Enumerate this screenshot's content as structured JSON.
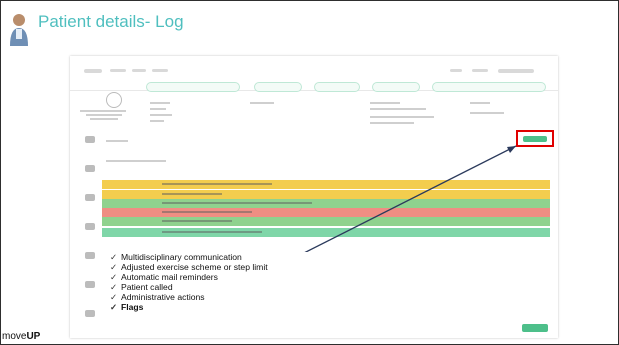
{
  "slide": {
    "title": "Patient details- Log",
    "brand_prefix": "move",
    "brand_suffix": "UP"
  },
  "features": [
    {
      "label": "Multidisciplinary communication",
      "bold": false
    },
    {
      "label": "Adjusted exercise scheme or step limit",
      "bold": false
    },
    {
      "label": "Automatic mail reminders",
      "bold": false
    },
    {
      "label": "Patient called",
      "bold": false
    },
    {
      "label": "Administrative actions",
      "bold": false
    },
    {
      "label": "Flags",
      "bold": true
    }
  ],
  "log_rows": [
    {
      "color": "yellow"
    },
    {
      "color": "yellow"
    },
    {
      "color": "green"
    },
    {
      "color": "red"
    },
    {
      "color": "green"
    },
    {
      "color": "lightgreen"
    }
  ],
  "colors": {
    "accent": "#4fbfbf",
    "yellow": "#f3cd4e",
    "green": "#8fd28e",
    "red": "#ef8e83",
    "lightgreen": "#7fd6a8",
    "highlight": "#e00000"
  }
}
